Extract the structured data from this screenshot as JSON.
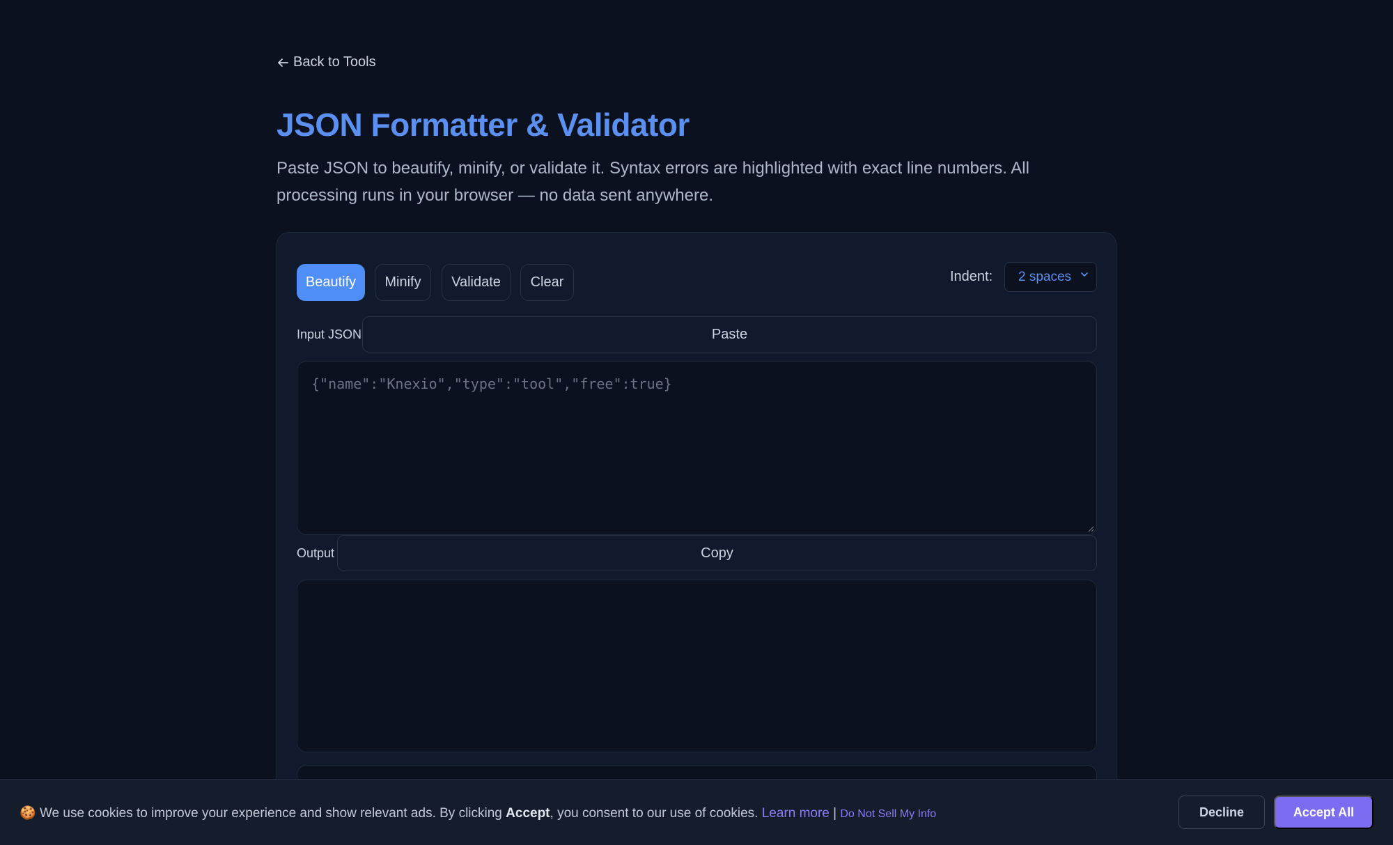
{
  "nav": {
    "back_label": "Back to Tools",
    "back_icon": "arrow-left-icon"
  },
  "header": {
    "title": "JSON Formatter & Validator",
    "description": "Paste JSON to beautify, minify, or validate it. Syntax errors are highlighted with exact line numbers. All processing runs in your browser — no data sent anywhere."
  },
  "toolbar": {
    "beautify_label": "Beautify",
    "minify_label": "Minify",
    "validate_label": "Validate",
    "clear_label": "Clear",
    "indent_label": "Indent:",
    "indent_value": "2 spaces",
    "active_tab": "Beautify"
  },
  "input": {
    "label": "Input JSON",
    "paste_label": "Paste",
    "placeholder": "{\"name\":\"Knexio\",\"type\":\"tool\",\"free\":true}",
    "value": ""
  },
  "output": {
    "label": "Output",
    "copy_label": "Copy",
    "value": ""
  },
  "cookie_banner": {
    "icon": "cookie-icon",
    "text_before": "We use cookies to improve your experience and show relevant ads. By clicking ",
    "text_bold": "Accept",
    "text_after": ", you consent to our use of cookies. ",
    "learn_more": "Learn more",
    "separator": "|",
    "do_not_sell": "Do Not Sell My Info",
    "decline_label": "Decline",
    "accept_label": "Accept All"
  },
  "colors": {
    "background": "#0b111e",
    "card": "#111a2c",
    "accent": "#4f8ef7",
    "title": "#5b8ff0",
    "accept_button": "#7c6cf2"
  }
}
